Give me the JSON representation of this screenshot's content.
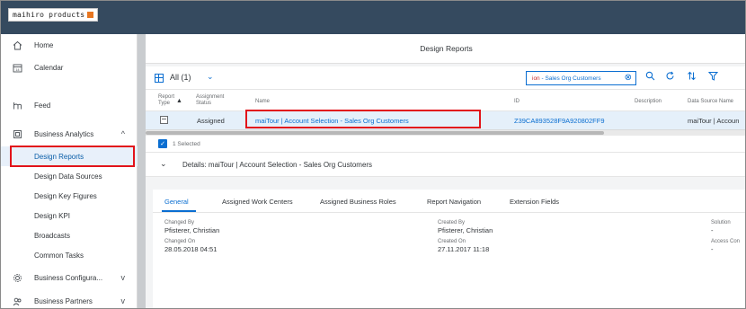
{
  "app": {
    "logo_text": "maihiro products"
  },
  "sidebar": {
    "items": [
      {
        "label": "Home"
      },
      {
        "label": "Calendar"
      },
      {
        "label": "Feed"
      },
      {
        "label": "Business Analytics"
      },
      {
        "label": "Business Configura..."
      },
      {
        "label": "Business Partners"
      }
    ],
    "subitems": [
      {
        "label": "Design Reports"
      },
      {
        "label": "Design Data Sources"
      },
      {
        "label": "Design Key Figures"
      },
      {
        "label": "Design KPI"
      },
      {
        "label": "Broadcasts"
      },
      {
        "label": "Common Tasks"
      }
    ]
  },
  "page": {
    "title": "Design Reports"
  },
  "toolbar": {
    "variant_label": "All (1)",
    "search_prefix": "ion",
    "search_value": " - Sales Org Customers"
  },
  "table": {
    "headers": {
      "report_type": "Report Type",
      "assignment_status": "Assignment Status",
      "name": "Name",
      "id": "ID",
      "description": "Description",
      "data_source_name": "Data Source Name"
    },
    "row": {
      "assignment_status": "Assigned",
      "name": "maiTour | Account Selection - Sales Org Customers",
      "id": "Z39CA893528F9A920802FF9",
      "description": "",
      "data_source_name": "maiTour | Accoun"
    }
  },
  "selection": {
    "text": "1 Selected"
  },
  "details": {
    "header": "Details: maiTour | Account Selection - Sales Org Customers",
    "tabs": [
      {
        "label": "General"
      },
      {
        "label": "Assigned Work Centers"
      },
      {
        "label": "Assigned Business Roles"
      },
      {
        "label": "Report Navigation"
      },
      {
        "label": "Extension Fields"
      }
    ],
    "fields": {
      "changed_by_label": "Changed By",
      "changed_by_value": "Pfisterer, Christian",
      "changed_on_label": "Changed On",
      "changed_on_value": "28.05.2018 04:51",
      "created_by_label": "Created By",
      "created_by_value": "Pfisterer, Christian",
      "created_on_label": "Created On",
      "created_on_value": "27.11.2017 11:18",
      "solution_label": "Solution",
      "solution_value": "-",
      "access_label": "Access Con",
      "access_value": "-"
    }
  },
  "colors": {
    "shell": "#354a5f",
    "accent": "#0a6ed1",
    "highlight_box": "#e2131a"
  }
}
